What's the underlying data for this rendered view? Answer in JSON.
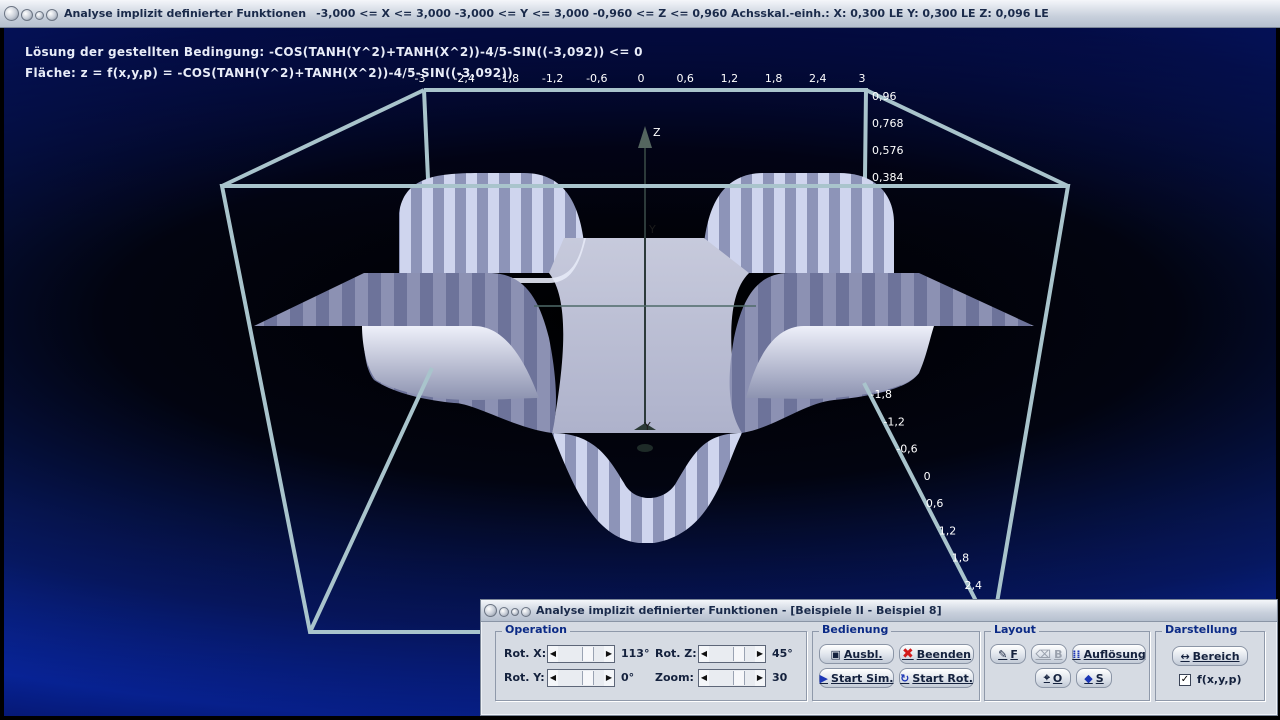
{
  "window": {
    "title": "Analyse implizit definierter Funktionen",
    "ranges": "-3,000 <= X <= 3,000   -3,000 <= Y <= 3,000   -0,960 <= Z <= 0,960   Achsskal.-einh.:  X: 0,300 LE    Y: 0,300 LE    Z: 0,096 LE"
  },
  "canvas": {
    "line1": "Lösung der gestellten Bedingung: -COS(TANH(Y^2)+TANH(X^2))-4/5-SIN((-3,092)) <= 0",
    "line2": "Fläche: z = f(x,y,p) = -COS(TANH(Y^2)+TANH(X^2))-4/5-SIN((-3,092))",
    "x_ticks": [
      "-3",
      "-2,4",
      "-1,8",
      "-1,2",
      "-0,6",
      "0",
      "0,6",
      "1,2",
      "1,8",
      "2,4",
      "3"
    ],
    "z_ticks": [
      "0,96",
      "0,768",
      "0,576",
      "0,384"
    ],
    "y_ticks": [
      "-1,8",
      "-1,2",
      "-0,6",
      "0",
      "0,6",
      "1,2",
      "1,8",
      "2,4"
    ],
    "axis_labels": {
      "z": "Z",
      "y_top": "Y",
      "y_bottom": "Y"
    },
    "colors": {
      "frame": "#a9c4cc",
      "surface": "#b9bfd6",
      "stripe": "#7d84a6"
    }
  },
  "panel": {
    "title": "Analyse implizit definierter Funktionen - [Beispiele II - Beispiel 8]",
    "operation": {
      "title": "Operation",
      "rot_x_label": "Rot. X:",
      "rot_x_value": "113°",
      "rot_y_label": "Rot. Y:",
      "rot_y_value": "0°",
      "rot_z_label": "Rot. Z:",
      "rot_z_value": "45°",
      "zoom_label": "Zoom:",
      "zoom_value": "30"
    },
    "bedienung": {
      "title": "Bedienung",
      "ausbl": "Ausbl.",
      "beenden": "Beenden",
      "start_sim": "Start Sim.",
      "start_rot": "Start Rot."
    },
    "layout": {
      "title": "Layout",
      "f": "F",
      "b": "B",
      "aufloesung": "Auflösung",
      "o": "O",
      "s": "S"
    },
    "darstellung": {
      "title": "Darstellung",
      "bereich": "Bereich",
      "fxyp_label": "f(x,y,p)",
      "fxyp_checked": true
    }
  }
}
